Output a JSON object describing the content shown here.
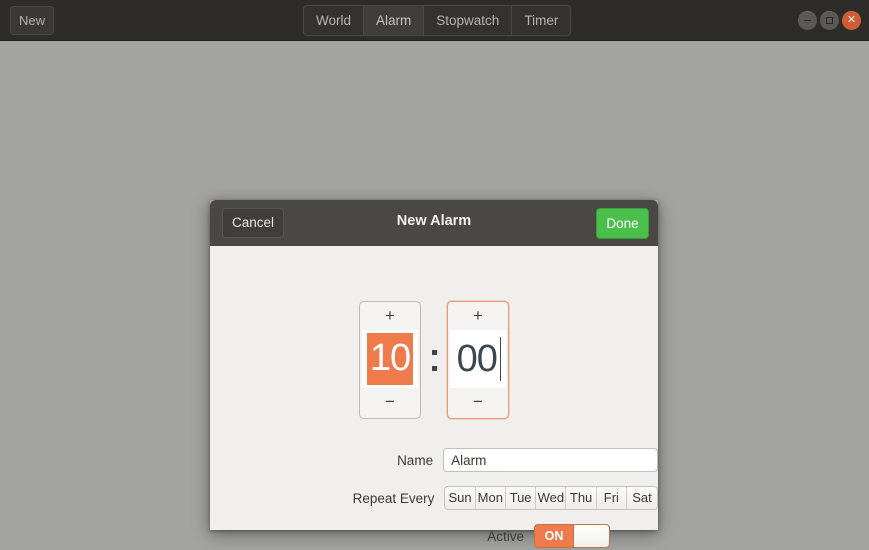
{
  "window": {
    "new_button": "New",
    "tabs": [
      {
        "label": "World",
        "active": false
      },
      {
        "label": "Alarm",
        "active": true
      },
      {
        "label": "Stopwatch",
        "active": false
      },
      {
        "label": "Timer",
        "active": false
      }
    ],
    "controls": {
      "minimize": "minimize-icon",
      "maximize": "maximize-icon",
      "close": "✕"
    },
    "colors": {
      "titlebar": "#2e2c2b",
      "desktop": "#a3a3a2",
      "accent_orange": "#ef7b4d",
      "done_green": "#4bbf4b"
    }
  },
  "dialog": {
    "title": "New Alarm",
    "cancel_label": "Cancel",
    "done_label": "Done",
    "time": {
      "hours": {
        "value": "10",
        "increment": "+",
        "decrement": "−",
        "selected": true,
        "focused": false
      },
      "minutes": {
        "value": "00",
        "increment": "+",
        "decrement": "−",
        "selected": false,
        "focused": true
      },
      "separator": ":"
    },
    "name_row": {
      "label": "Name",
      "value": "Alarm",
      "placeholder": "Alarm"
    },
    "repeat_row": {
      "label": "Repeat Every",
      "days": [
        {
          "label": "Sun",
          "selected": false
        },
        {
          "label": "Mon",
          "selected": false
        },
        {
          "label": "Tue",
          "selected": false
        },
        {
          "label": "Wed",
          "selected": false
        },
        {
          "label": "Thu",
          "selected": false
        },
        {
          "label": "Fri",
          "selected": false
        },
        {
          "label": "Sat",
          "selected": false
        }
      ]
    },
    "active_row": {
      "label": "Active",
      "state": "ON"
    }
  }
}
